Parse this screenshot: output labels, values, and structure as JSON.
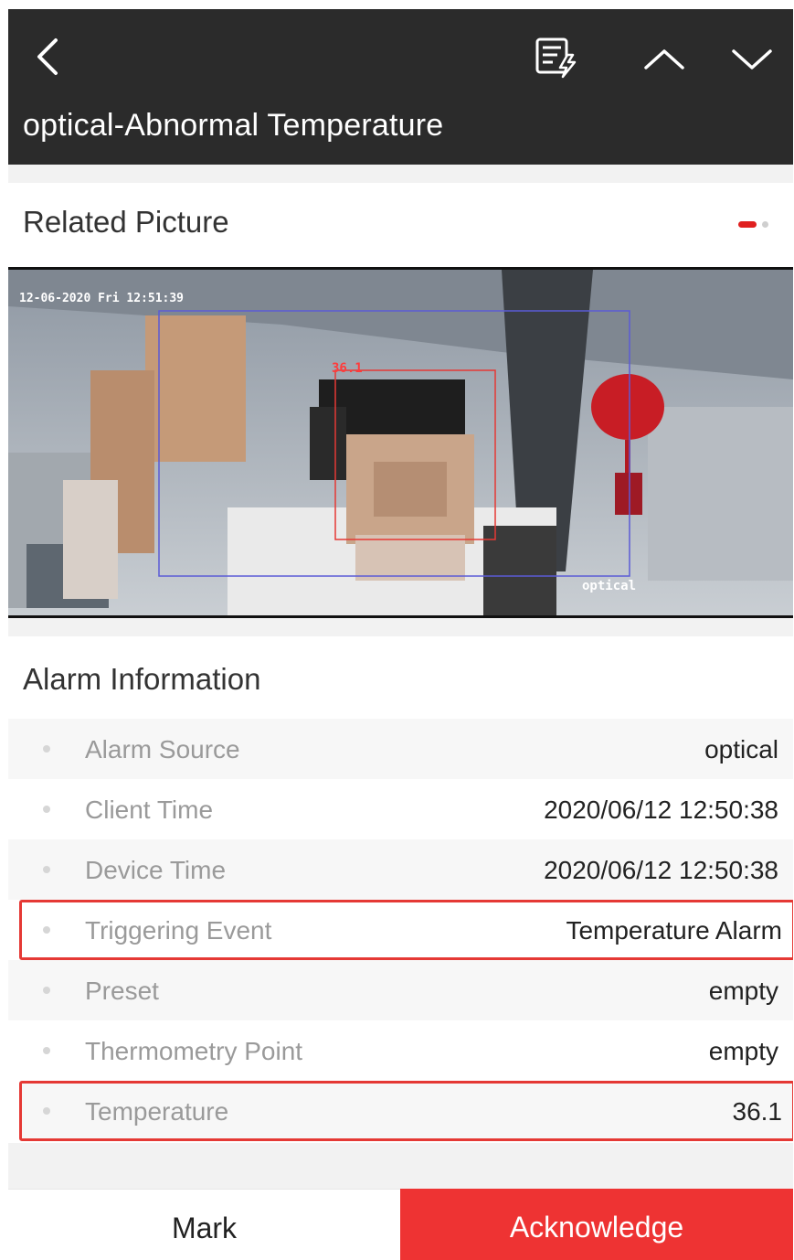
{
  "header": {
    "title": "optical-Abnormal Temperature",
    "icons": [
      "back-icon",
      "event-report-icon",
      "chevron-up-icon",
      "chevron-down-icon"
    ]
  },
  "related_picture": {
    "label": "Related Picture",
    "pager_active_color": "#e0201f",
    "osd_timestamp": "12-06-2020 Fri 12:51:39",
    "osd_temperature": "36.1",
    "osd_camera": "optical"
  },
  "alarm_info": {
    "label": "Alarm Information",
    "rows": [
      {
        "key": "Alarm Source",
        "value": "optical"
      },
      {
        "key": "Client Time",
        "value": "2020/06/12 12:50:38"
      },
      {
        "key": "Device Time",
        "value": "2020/06/12 12:50:38"
      },
      {
        "key": "Triggering Event",
        "value": "Temperature Alarm"
      },
      {
        "key": "Preset",
        "value": "empty"
      },
      {
        "key": "Thermometry Point",
        "value": "empty"
      },
      {
        "key": "Temperature",
        "value": "36.1"
      }
    ]
  },
  "footer": {
    "mark_label": "Mark",
    "acknowledge_label": "Acknowledge",
    "accent_color": "#ee3333"
  }
}
